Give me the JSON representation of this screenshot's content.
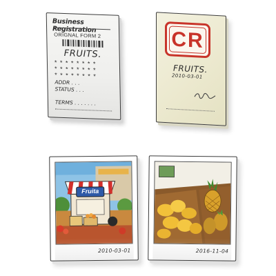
{
  "registration_document": {
    "heading": "Business Registration",
    "original_label": "ORIGNAL FORM 2",
    "company_name": "FRUITS.",
    "stars_row_1": "* * * * * * * *",
    "stars_row_2": "* * * * * * * *",
    "stars_row_3": "* * * * * * * *",
    "addr_label": "ADDR . . .",
    "status_label": "STATUS . . .",
    "terms_label": "TERMS . . . . . . ."
  },
  "cr_certificate": {
    "badge_text": "CR",
    "badge_color": "#c8342a",
    "company_name": "FRUITS.",
    "date": "2010-03-01"
  },
  "storefront_photo": {
    "shop_sign": "Fruita",
    "date": "2010-03-01"
  },
  "produce_photo": {
    "date": "2016-11-04"
  }
}
